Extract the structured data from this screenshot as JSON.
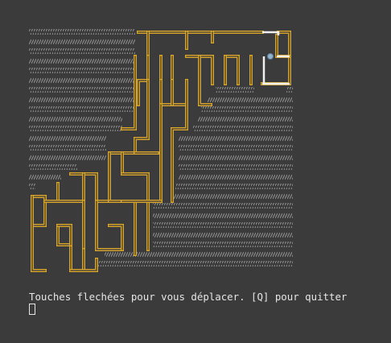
{
  "game": {
    "help_text": "Touches flechées pour vous déplacer. [Q] pour quitter"
  },
  "colors": {
    "background": "#3b3b3b",
    "wall": "#d9a52b",
    "wall_highlight": "#f0f0f0",
    "fog": "#8c8c8c",
    "player": "#8fb2cf",
    "text": "#e6e6e6"
  },
  "icons": {
    "player": "player-token-icon",
    "fog": "fog-hatch-icon",
    "cursor": "text-cursor-icon"
  }
}
